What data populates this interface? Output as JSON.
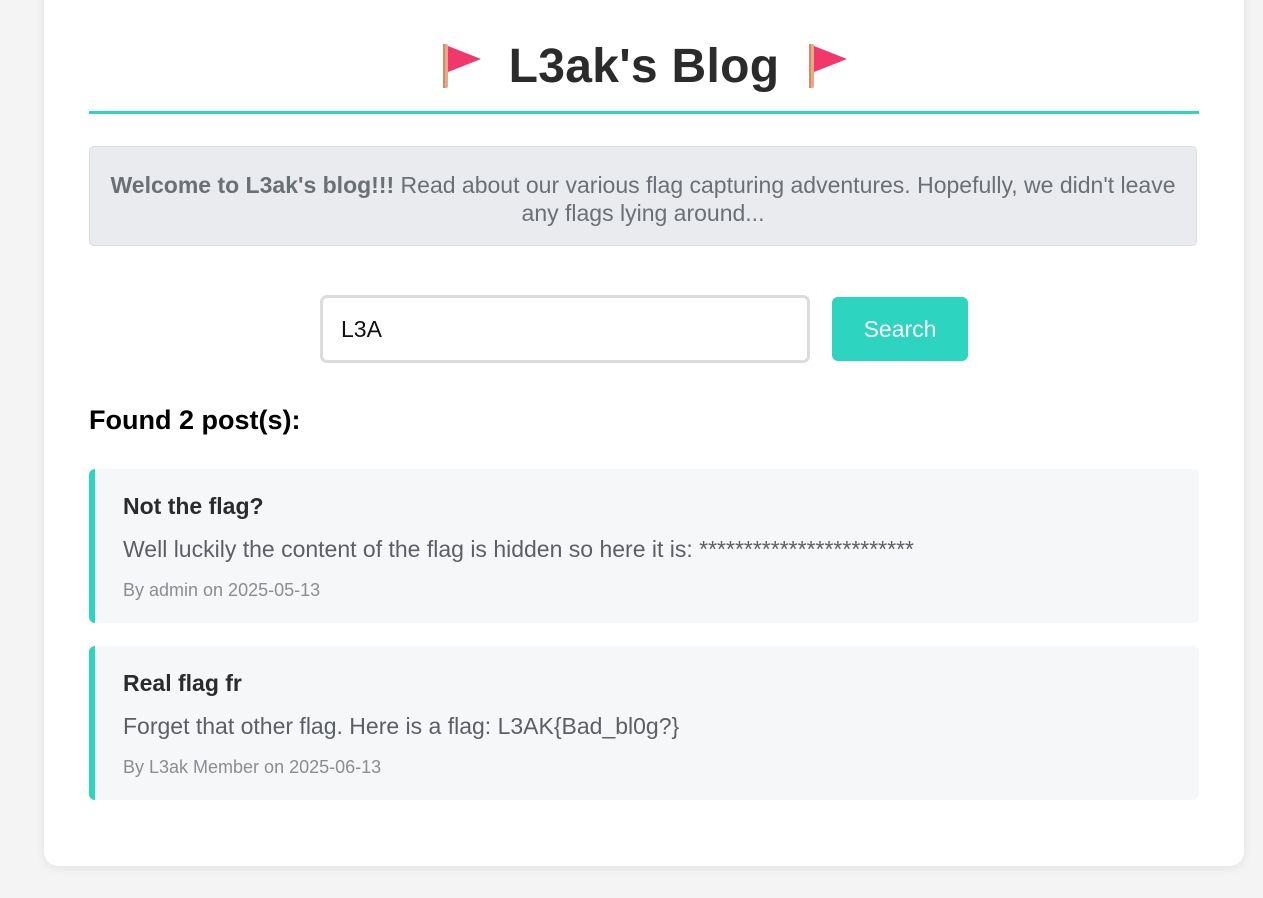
{
  "header": {
    "title": "L3ak's Blog",
    "flag_icon": "triangular-flag-icon",
    "flag_color": "#f0386b"
  },
  "welcome": {
    "bold": "Welcome to L3ak's blog!!!",
    "text": " Read about our various flag capturing adventures. Hopefully, we didn't leave any flags lying around..."
  },
  "search": {
    "value": "L3A",
    "button_label": "Search"
  },
  "results": {
    "heading": "Found 2 post(s):",
    "posts": [
      {
        "title": "Not the flag?",
        "content": "Well luckily the content of the flag is hidden so here it is: ************************",
        "meta": "By admin on 2025-05-13"
      },
      {
        "title": "Real flag fr",
        "content": "Forget that other flag. Here is a flag: L3AK{Bad_bl0g?}",
        "meta": "By L3ak Member on 2025-06-13"
      }
    ]
  },
  "colors": {
    "accent": "#2dd4bf",
    "background": "#f4f4f4",
    "welcome_bg": "#e9ebef",
    "post_bg": "#f6f7f9"
  }
}
